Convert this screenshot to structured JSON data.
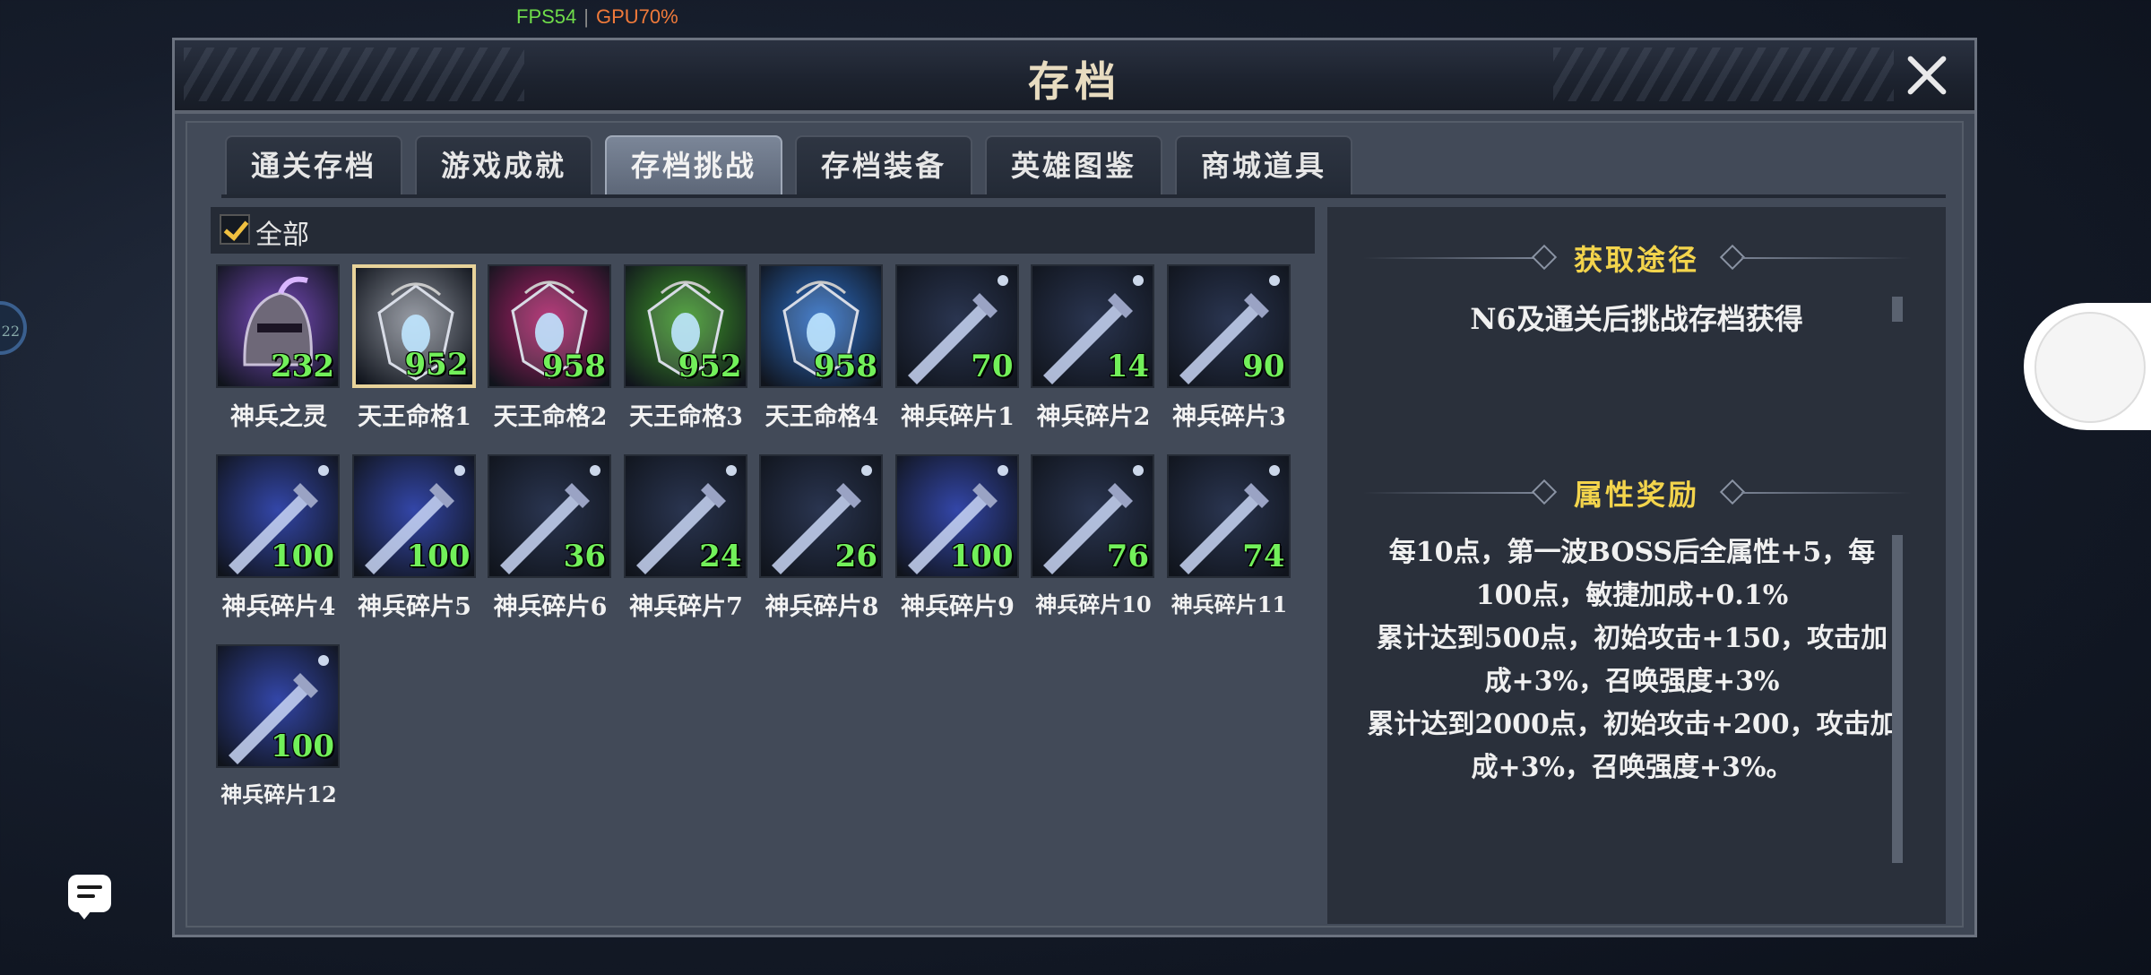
{
  "hud": {
    "fps": "FPS54",
    "gpu": "GPU70%"
  },
  "window": {
    "title": "存档"
  },
  "tabs": [
    {
      "label": "通关存档",
      "active": false
    },
    {
      "label": "游戏成就",
      "active": false
    },
    {
      "label": "存档挑战",
      "active": true
    },
    {
      "label": "存档装备",
      "active": false
    },
    {
      "label": "英雄图鉴",
      "active": false
    },
    {
      "label": "商城道具",
      "active": false
    }
  ],
  "filter": {
    "label": "全部",
    "checked": true
  },
  "items": [
    {
      "name": "神兵之灵",
      "count": "232",
      "icon": "helmet-icon",
      "color": "#7a4cc0"
    },
    {
      "name": "天王命格1",
      "count": "952",
      "icon": "amulet-icon",
      "color": "#8a8f99",
      "selected": true
    },
    {
      "name": "天王命格2",
      "count": "958",
      "icon": "amulet-icon",
      "color": "#b0206a"
    },
    {
      "name": "天王命格3",
      "count": "952",
      "icon": "amulet-icon",
      "color": "#3f9a2a"
    },
    {
      "name": "天王命格4",
      "count": "958",
      "icon": "amulet-icon",
      "color": "#2d6fc8"
    },
    {
      "name": "神兵碎片1",
      "count": "70",
      "icon": "sword-fragment-icon",
      "color": "#2a3550"
    },
    {
      "name": "神兵碎片2",
      "count": "14",
      "icon": "sword-fragment-icon",
      "color": "#2a3550"
    },
    {
      "name": "神兵碎片3",
      "count": "90",
      "icon": "sword-fragment-icon",
      "color": "#2a3550"
    },
    {
      "name": "神兵碎片4",
      "count": "100",
      "icon": "sword-fragment-icon",
      "color": "#3346a8"
    },
    {
      "name": "神兵碎片5",
      "count": "100",
      "icon": "sword-fragment-icon",
      "color": "#3346a8"
    },
    {
      "name": "神兵碎片6",
      "count": "36",
      "icon": "sword-fragment-icon",
      "color": "#2a3550"
    },
    {
      "name": "神兵碎片7",
      "count": "24",
      "icon": "sword-fragment-icon",
      "color": "#2a3550"
    },
    {
      "name": "神兵碎片8",
      "count": "26",
      "icon": "sword-fragment-icon",
      "color": "#2a3550"
    },
    {
      "name": "神兵碎片9",
      "count": "100",
      "icon": "sword-fragment-icon",
      "color": "#3346a8"
    },
    {
      "name": "神兵碎片10",
      "count": "76",
      "icon": "sword-fragment-icon",
      "color": "#2a3550"
    },
    {
      "name": "神兵碎片11",
      "count": "74",
      "icon": "sword-fragment-icon",
      "color": "#2a3550"
    },
    {
      "name": "神兵碎片12",
      "count": "100",
      "icon": "sword-fragment-icon",
      "color": "#3346a8"
    }
  ],
  "detail": {
    "source_title": "获取途径",
    "source_text": "N6及通关后挑战存档获得",
    "reward_title": "属性奖励",
    "reward_lines": [
      "每10点，第一波BOSS后全属性+5，每100点，敏捷加成+0.1%",
      "累计达到500点，初始攻击+150，攻击加成+3%，召唤强度+3%",
      "累计达到2000点，初始攻击+200，攻击加成+3%，召唤强度+3%。"
    ]
  }
}
